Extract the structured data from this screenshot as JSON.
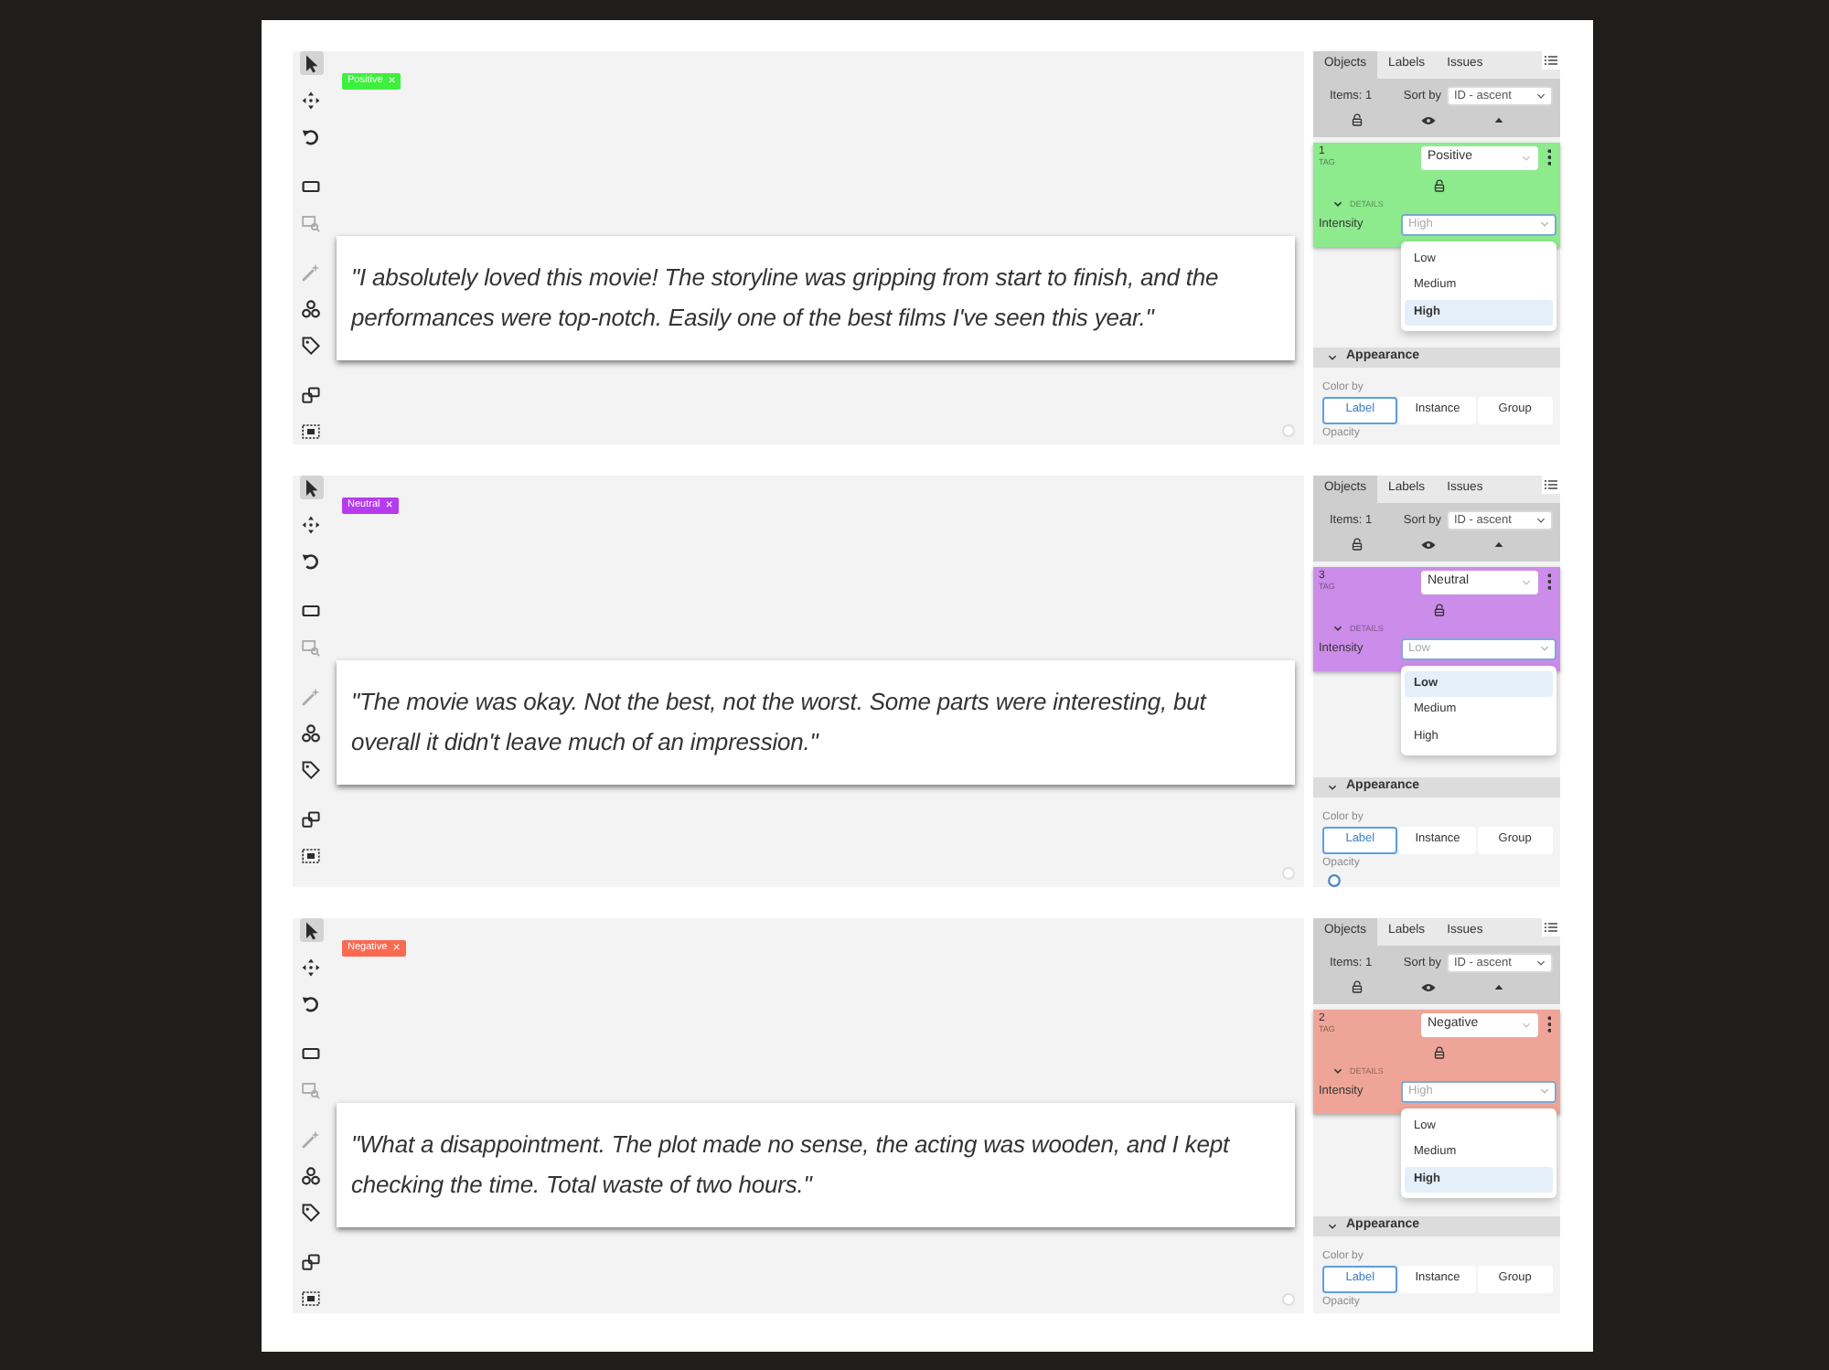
{
  "panels": [
    {
      "toolbar": [
        {
          "kind": "pointer",
          "selected": true,
          "disabled": false
        },
        {
          "kind": "move",
          "selected": false,
          "disabled": false
        },
        {
          "kind": "undo",
          "selected": false,
          "disabled": false
        },
        {
          "kind": "rectangle",
          "selected": false,
          "disabled": false
        },
        {
          "kind": "zoom-region",
          "selected": false,
          "disabled": true
        },
        {
          "kind": "magic-wand",
          "selected": false,
          "disabled": true
        },
        {
          "kind": "three-circles",
          "selected": false,
          "disabled": false
        },
        {
          "kind": "tag",
          "selected": false,
          "disabled": false
        },
        {
          "kind": "squares",
          "selected": false,
          "disabled": false
        },
        {
          "kind": "frame",
          "selected": false,
          "disabled": false
        }
      ],
      "tag": {
        "label": "Positive",
        "remove": "×",
        "color": "#3df03d"
      },
      "text": "\"I absolutely loved this movie! The storyline was gripping from start to finish, and the performances were top-notch. Easily one of the best films I've seen this year.\"",
      "sidebar": {
        "tabs": [
          {
            "label": "Objects",
            "selected": true
          },
          {
            "label": "Labels",
            "selected": false
          },
          {
            "label": "Issues",
            "selected": false
          }
        ],
        "items_count": "Items: 1",
        "sort_label": "Sort by",
        "sort_value": "ID - ascent",
        "object": {
          "id": "1",
          "type": "TAG",
          "label": "Positive",
          "details": "DETAILS",
          "attribute_label": "Intensity",
          "attribute_value": "High",
          "options": [
            {
              "label": "Low",
              "selected": false
            },
            {
              "label": "Medium",
              "selected": false
            },
            {
              "label": "High",
              "selected": true
            }
          ]
        },
        "appearance": {
          "title": "Appearance",
          "color_by_label": "Color by",
          "color_by": [
            {
              "label": "Label",
              "selected": true
            },
            {
              "label": "Instance",
              "selected": false
            },
            {
              "label": "Group",
              "selected": false
            }
          ],
          "opacity_label": "Opacity"
        }
      }
    },
    {
      "toolbar": [
        {
          "kind": "pointer",
          "selected": true,
          "disabled": false
        },
        {
          "kind": "move",
          "selected": false,
          "disabled": false
        },
        {
          "kind": "undo",
          "selected": false,
          "disabled": false
        },
        {
          "kind": "rectangle",
          "selected": false,
          "disabled": false
        },
        {
          "kind": "zoom-region",
          "selected": false,
          "disabled": true
        },
        {
          "kind": "magic-wand",
          "selected": false,
          "disabled": true
        },
        {
          "kind": "three-circles",
          "selected": false,
          "disabled": false
        },
        {
          "kind": "tag",
          "selected": false,
          "disabled": false
        },
        {
          "kind": "squares",
          "selected": false,
          "disabled": false
        },
        {
          "kind": "frame",
          "selected": false,
          "disabled": false
        }
      ],
      "tag": {
        "label": "Neutral",
        "remove": "×",
        "color": "#b63bef"
      },
      "text": "\"The movie was okay. Not the best, not the worst. Some parts were interesting, but overall it didn't leave much of an impression.\"",
      "sidebar": {
        "tabs": [
          {
            "label": "Objects",
            "selected": true
          },
          {
            "label": "Labels",
            "selected": false
          },
          {
            "label": "Issues",
            "selected": false
          }
        ],
        "items_count": "Items: 1",
        "sort_label": "Sort by",
        "sort_value": "ID - ascent",
        "object": {
          "id": "3",
          "type": "TAG",
          "label": "Neutral",
          "details": "DETAILS",
          "attribute_label": "Intensity",
          "attribute_value": "Low",
          "options": [
            {
              "label": "Low",
              "selected": true
            },
            {
              "label": "Medium",
              "selected": false
            },
            {
              "label": "High",
              "selected": false
            }
          ]
        },
        "appearance": {
          "title": "Appearance",
          "color_by_label": "Color by",
          "color_by": [
            {
              "label": "Label",
              "selected": true
            },
            {
              "label": "Instance",
              "selected": false
            },
            {
              "label": "Group",
              "selected": false
            }
          ],
          "opacity_label": "Opacity",
          "opacity_thumb": true
        }
      }
    },
    {
      "toolbar": [
        {
          "kind": "pointer",
          "selected": true,
          "disabled": false
        },
        {
          "kind": "move",
          "selected": false,
          "disabled": false
        },
        {
          "kind": "undo",
          "selected": false,
          "disabled": false
        },
        {
          "kind": "rectangle",
          "selected": false,
          "disabled": false
        },
        {
          "kind": "zoom-region",
          "selected": false,
          "disabled": true
        },
        {
          "kind": "magic-wand",
          "selected": false,
          "disabled": true
        },
        {
          "kind": "three-circles",
          "selected": false,
          "disabled": false
        },
        {
          "kind": "tag",
          "selected": false,
          "disabled": false
        },
        {
          "kind": "squares",
          "selected": false,
          "disabled": false
        },
        {
          "kind": "frame",
          "selected": false,
          "disabled": false
        }
      ],
      "tag": {
        "label": "Negative",
        "remove": "×",
        "color": "#f86a52"
      },
      "text": "\"What a disappointment. The plot made no sense, the acting was wooden, and I kept checking the time. Total waste of two hours.\"",
      "sidebar": {
        "tabs": [
          {
            "label": "Objects",
            "selected": true
          },
          {
            "label": "Labels",
            "selected": false
          },
          {
            "label": "Issues",
            "selected": false
          }
        ],
        "items_count": "Items: 1",
        "sort_label": "Sort by",
        "sort_value": "ID - ascent",
        "object": {
          "id": "2",
          "type": "TAG",
          "label": "Negative",
          "details": "DETAILS",
          "attribute_label": "Intensity",
          "attribute_value": "High",
          "options": [
            {
              "label": "Low",
              "selected": false
            },
            {
              "label": "Medium",
              "selected": false
            },
            {
              "label": "High",
              "selected": true
            }
          ]
        },
        "appearance": {
          "title": "Appearance",
          "color_by_label": "Color by",
          "color_by": [
            {
              "label": "Label",
              "selected": true
            },
            {
              "label": "Instance",
              "selected": false
            },
            {
              "label": "Group",
              "selected": false
            }
          ],
          "opacity_label": "Opacity"
        }
      }
    }
  ]
}
